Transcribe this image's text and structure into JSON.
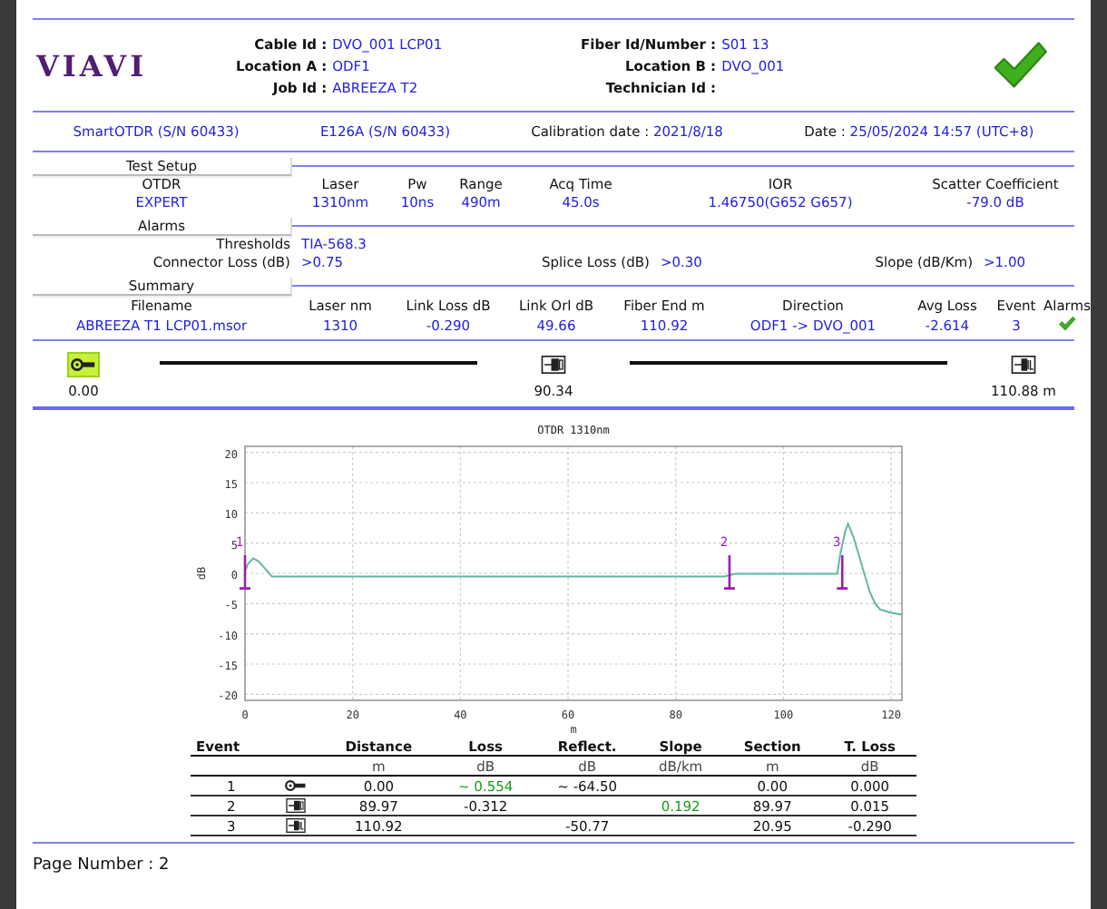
{
  "header": {
    "logo": "VIAVI",
    "fields_left": [
      {
        "label": "Cable Id :",
        "value": "DVO_001 LCP01"
      },
      {
        "label": "Location A :",
        "value": "ODF1"
      },
      {
        "label": "Job Id :",
        "value": "ABREEZA T2"
      }
    ],
    "fields_right": [
      {
        "label": "Fiber Id/Number :",
        "value": "S01 13"
      },
      {
        "label": "Location B :",
        "value": "DVO_001"
      },
      {
        "label": "Technician Id :"
      }
    ],
    "passed": true
  },
  "instrument": {
    "device": "SmartOTDR (S/N 60433)",
    "module": "E126A (S/N 60433)",
    "calibration_label": "Calibration date :",
    "calibration": "2021/8/18",
    "date_label": "Date :",
    "date": "25/05/2024 14:57 (UTC+8)"
  },
  "test_setup": {
    "title": "Test Setup",
    "columns": [
      {
        "label": "OTDR",
        "value": "EXPERT"
      },
      {
        "label": "Laser",
        "value": "1310nm"
      },
      {
        "label": "Pw",
        "value": "10ns"
      },
      {
        "label": "Range",
        "value": "490m"
      },
      {
        "label": "Acq Time",
        "value": "45.0s"
      },
      {
        "label": "IOR",
        "value": "1.46750(G652 G657)"
      },
      {
        "label": "Scatter Coefficient",
        "value": "-79.0 dB"
      }
    ]
  },
  "alarms": {
    "title": "Alarms",
    "thresholds_label": "Thresholds",
    "thresholds": "TIA-568.3",
    "items": [
      {
        "label": "Connector Loss (dB)",
        "value": ">0.75"
      },
      {
        "label": "Splice Loss (dB)",
        "value": ">0.30"
      },
      {
        "label": "Slope (dB/Km)",
        "value": ">1.00"
      }
    ]
  },
  "summary": {
    "title": "Summary",
    "columns": [
      {
        "label": "Filename",
        "value": "ABREEZA T1 LCP01.msor",
        "kind": "text"
      },
      {
        "label": "Laser nm",
        "value": "1310",
        "kind": "text"
      },
      {
        "label": "Link Loss dB",
        "value": "-0.290",
        "kind": "text"
      },
      {
        "label": "Link Orl dB",
        "value": "49.66",
        "kind": "text"
      },
      {
        "label": "Fiber End m",
        "value": "110.92",
        "kind": "text"
      },
      {
        "label": "Direction",
        "value": "ODF1 -> DVO_001",
        "kind": "text"
      },
      {
        "label": "Avg Loss",
        "value": "-2.614",
        "kind": "text"
      },
      {
        "label": "Event",
        "value": "3",
        "kind": "text"
      },
      {
        "label": "Alarms",
        "kind": "pass"
      }
    ]
  },
  "link_view": [
    {
      "kind": "start",
      "label": "0.00",
      "highlighted": true
    },
    {
      "kind": "connector",
      "label": "90.34",
      "highlighted": false
    },
    {
      "kind": "end",
      "label": "110.88 m",
      "highlighted": false
    }
  ],
  "trace": {
    "markers": [
      "1",
      "2",
      "3"
    ],
    "chart_data": {
      "type": "line",
      "title": "OTDR 1310nm",
      "xlabel": "m",
      "ylabel": "dB",
      "grid": true,
      "xlim": [
        0,
        122
      ],
      "ylim": [
        -21,
        21
      ],
      "xticks": [
        0,
        20,
        40,
        60,
        80,
        100,
        120
      ],
      "yticks": [
        -20,
        -15,
        -10,
        -5,
        0,
        5,
        10,
        15,
        20
      ],
      "x": [
        0,
        0.5,
        1.5,
        2.5,
        4,
        5,
        89,
        91,
        110,
        110.5,
        111.5,
        112,
        113,
        114,
        115,
        116,
        117,
        118,
        120,
        122
      ],
      "series": [
        {
          "color": "#5fb8a6",
          "values": [
            0.4,
            1.5,
            2.5,
            2,
            0.5,
            -0.5,
            -0.5,
            -0.1,
            -0.1,
            3,
            7,
            8.2,
            6,
            3,
            0,
            -3,
            -5,
            -6,
            -6.5,
            -6.8
          ]
        }
      ]
    }
  },
  "events": {
    "columns": [
      {
        "label": "Event"
      },
      {},
      {
        "label": "Distance",
        "unit": "m"
      },
      {
        "label": "Loss",
        "unit": "dB"
      },
      {
        "label": "Reflect.",
        "unit": "dB"
      },
      {
        "label": "Slope",
        "unit": "dB/km"
      },
      {
        "label": "Section",
        "unit": "m"
      },
      {
        "label": "T. Loss",
        "unit": "dB"
      }
    ],
    "rows": [
      {
        "number": "1",
        "kind": "start",
        "distance": "0.00",
        "loss": "~ 0.554",
        "loss_pass": true,
        "reflect": "~ -64.50",
        "section": "0.00",
        "total_loss": "0.000"
      },
      {
        "number": "2",
        "kind": "connector",
        "distance": "89.97",
        "loss": "-0.312",
        "loss_pass": false,
        "slope": "0.192",
        "slope_pass": true,
        "section": "89.97",
        "total_loss": "0.015"
      },
      {
        "number": "3",
        "kind": "end",
        "distance": "110.92",
        "reflect": "-50.77",
        "section": "20.95",
        "total_loss": "-0.290"
      }
    ]
  },
  "footer": {
    "page_number": "Page Number : 2"
  }
}
